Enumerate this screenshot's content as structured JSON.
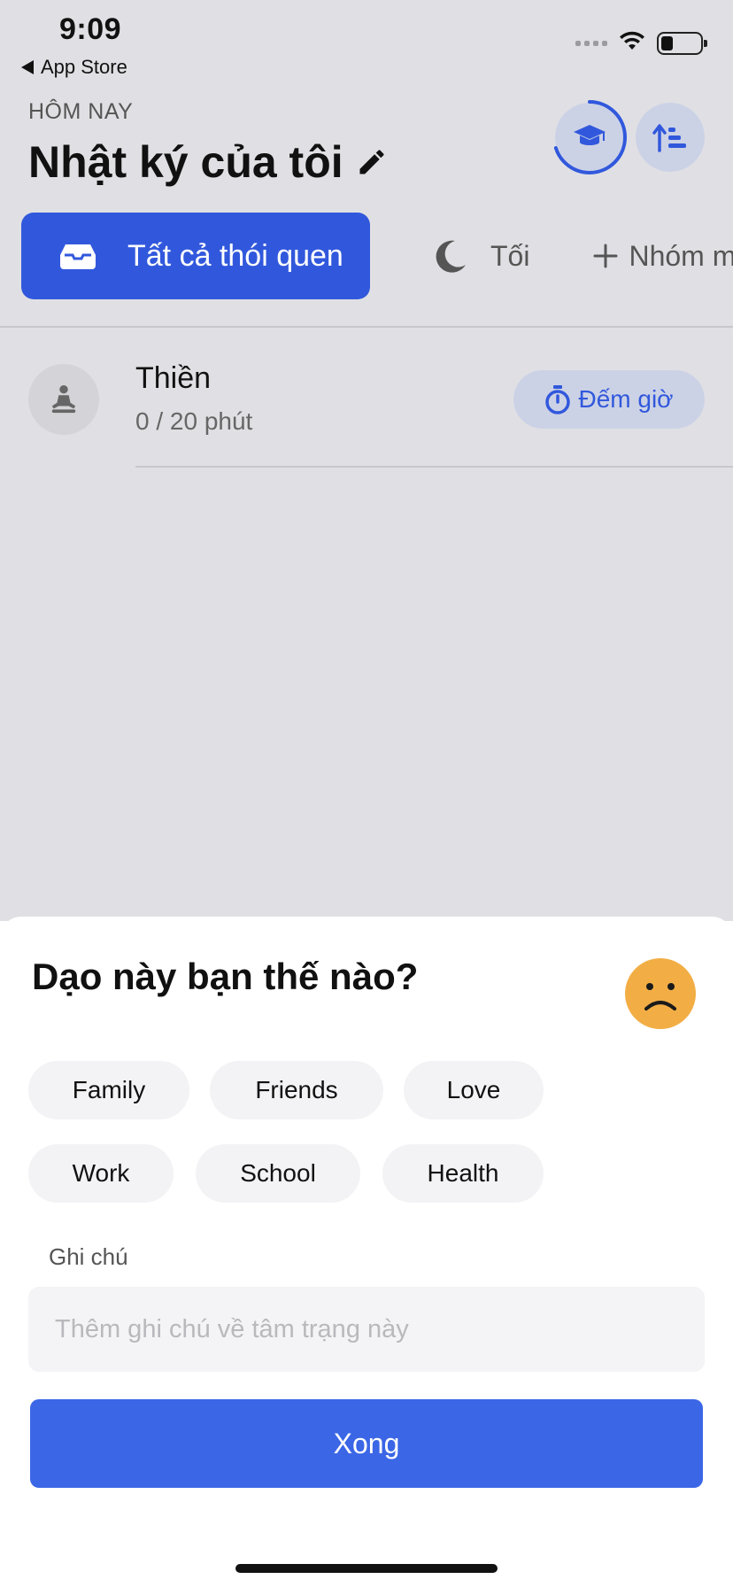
{
  "status_bar": {
    "time": "9:09",
    "back_label": "App Store",
    "battery_level": 0.3
  },
  "header": {
    "subtitle": "HÔM NAY",
    "title": "Nhật ký của tôi",
    "progress_ring": 0.7
  },
  "tabs": {
    "active_label": "Tất cả thói quen",
    "second_label": "Tối",
    "add_label": "Nhóm m"
  },
  "habit": {
    "name": "Thiền",
    "progress": "0 / 20 phút",
    "timer_label": "Đếm giờ"
  },
  "sheet": {
    "title": "Dạo này bạn thế nào?",
    "tags": [
      "Family",
      "Friends",
      "Love",
      "Work",
      "School",
      "Health"
    ],
    "note_label": "Ghi chú",
    "note_placeholder": "Thêm ghi chú về tâm trạng này",
    "done_label": "Xong"
  },
  "colors": {
    "accent": "#3158dc",
    "button": "#3b66e6",
    "mood_face": "#f2ae45",
    "background_dim": "#e0e0e4"
  }
}
